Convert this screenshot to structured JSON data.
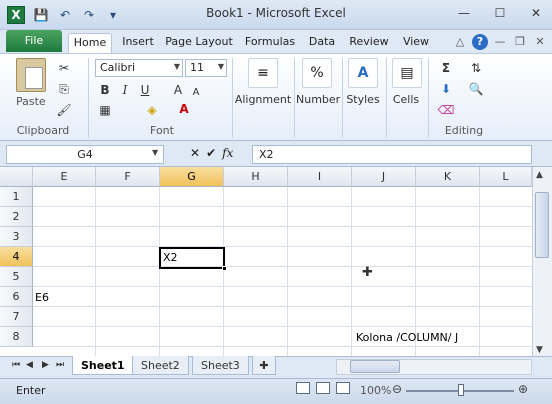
{
  "window": {
    "title": "Book1 - Microsoft Excel",
    "app_icon": "X",
    "minimize": "—",
    "maximize": "☐",
    "close": "✕"
  },
  "qat": {
    "save": "💾",
    "undo": "↶",
    "redo": "↷",
    "more": "▾"
  },
  "tabs": {
    "file": "File",
    "items": [
      "Home",
      "Insert",
      "Page Layout",
      "Formulas",
      "Data",
      "Review",
      "View"
    ]
  },
  "tab_controls": {
    "collapse": "△",
    "help": "?",
    "min": "—",
    "restore": "❐",
    "close": "✕"
  },
  "ribbon": {
    "clipboard": {
      "label": "Clipboard",
      "paste": "Paste"
    },
    "font": {
      "label": "Font",
      "name": "Calibri",
      "size": "11",
      "bold": "B",
      "italic": "I",
      "underline": "U"
    },
    "alignment": {
      "label": "Alignment"
    },
    "number": {
      "label": "Number",
      "icon": "%"
    },
    "styles": {
      "label": "Styles"
    },
    "cells": {
      "label": "Cells"
    },
    "editing": {
      "label": "Editing",
      "sum": "Σ"
    }
  },
  "formula_bar": {
    "name_box": "G4",
    "cancel": "✕",
    "enter": "✔",
    "fx": "fx",
    "value": "X2"
  },
  "grid": {
    "columns": [
      "E",
      "F",
      "G",
      "H",
      "I",
      "J",
      "K",
      "L"
    ],
    "rows": [
      "1",
      "2",
      "3",
      "4",
      "5",
      "6",
      "7",
      "8"
    ],
    "active_column": "G",
    "active_row": "4",
    "cells": {
      "G4": "X2",
      "E6": "E6",
      "J8": "Kolona /COLUMN/ J"
    }
  },
  "sheets": {
    "tabs": [
      "Sheet1",
      "Sheet2",
      "Sheet3"
    ],
    "active": "Sheet1"
  },
  "status": {
    "mode": "Enter",
    "zoom": "100%",
    "zoom_level": 1.0
  }
}
